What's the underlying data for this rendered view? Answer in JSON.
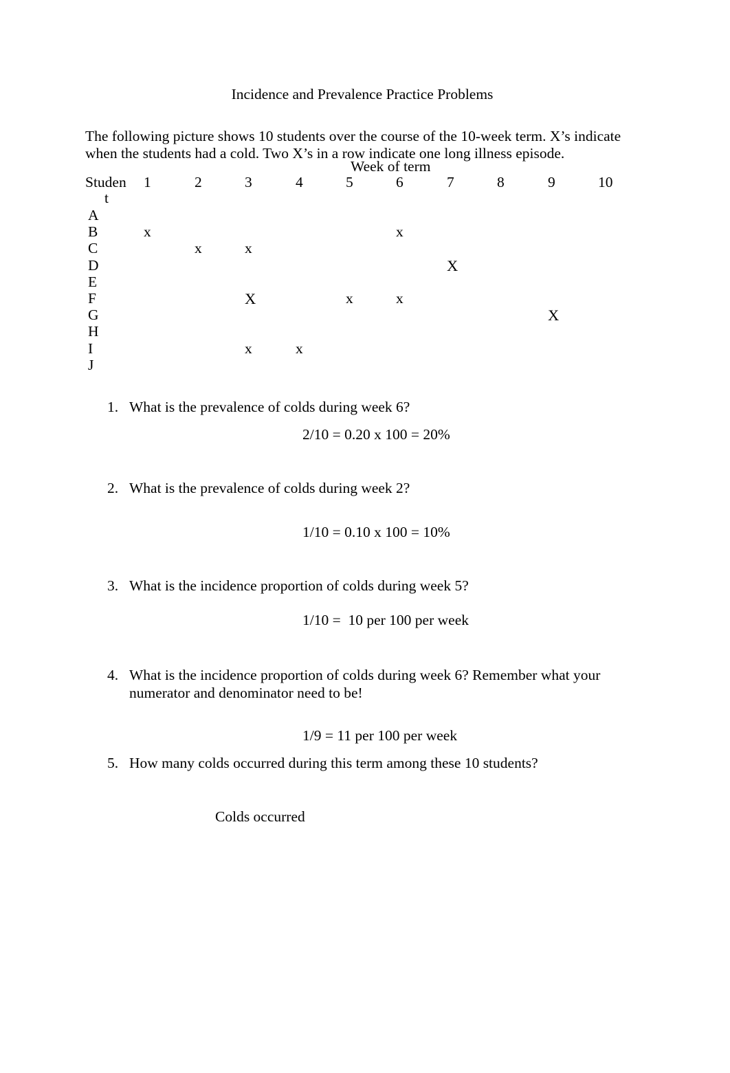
{
  "document": {
    "title": "Incidence and Prevalence Practice Problems",
    "intro": "The following picture shows 10 students over the course of the 10-week term. X’s indicate when the students had a cold. Two X’s in a row indicate one long illness episode."
  },
  "table": {
    "supertitle": "Week of term",
    "row_header_line1": "Studen",
    "row_header_line2": "t",
    "week_columns": [
      "1",
      "2",
      "3",
      "4",
      "5",
      "6",
      "7",
      "8",
      "9",
      "10"
    ],
    "rows": [
      {
        "student": "A",
        "marks": [
          "",
          "",
          "",
          "",
          "",
          "",
          "",
          "",
          "",
          ""
        ]
      },
      {
        "student": "B",
        "marks": [
          "x",
          "",
          "",
          "",
          "",
          "x",
          "",
          "",
          "",
          ""
        ]
      },
      {
        "student": "C",
        "marks": [
          "",
          "x",
          "x",
          "",
          "",
          "",
          "",
          "",
          "",
          ""
        ]
      },
      {
        "student": "D",
        "marks": [
          "",
          "",
          "",
          "",
          "",
          "",
          "X",
          "",
          "",
          ""
        ]
      },
      {
        "student": "E",
        "marks": [
          "",
          "",
          "",
          "",
          "",
          "",
          "",
          "",
          "",
          ""
        ]
      },
      {
        "student": "F",
        "marks": [
          "",
          "",
          "X",
          "",
          "x",
          "x",
          "",
          "",
          "",
          ""
        ]
      },
      {
        "student": "G",
        "marks": [
          "",
          "",
          "",
          "",
          "",
          "",
          "",
          "",
          "X",
          ""
        ]
      },
      {
        "student": "H",
        "marks": [
          "",
          "",
          "",
          "",
          "",
          "",
          "",
          "",
          "",
          ""
        ]
      },
      {
        "student": "I",
        "marks": [
          "",
          "",
          "x",
          "x",
          "",
          "",
          "",
          "",
          "",
          ""
        ]
      },
      {
        "student": "J",
        "marks": [
          "",
          "",
          "",
          "",
          "",
          "",
          "",
          "",
          "",
          ""
        ]
      }
    ]
  },
  "questions": [
    {
      "number": "1.",
      "text": "What is the prevalence of colds during week 6?",
      "answer": "2/10 = 0.20 x 100 = 20%"
    },
    {
      "number": "2.",
      "text": "What is the prevalence of colds during week 2?",
      "answer": "1/10 = 0.10 x 100 = 10%"
    },
    {
      "number": "3.",
      "text": "What is the incidence proportion of colds during week 5?",
      "answer": "1/10 =  10 per 100 per week"
    },
    {
      "number": "4.",
      "text": "What is the incidence proportion of colds during week 6? Remember what your numerator and denominator need to be!",
      "answer": "1/9 = 11 per 100 per week"
    },
    {
      "number": "5.",
      "text": "How many colds occurred during this term among these 10 students?",
      "answer": "Colds occurred"
    }
  ]
}
